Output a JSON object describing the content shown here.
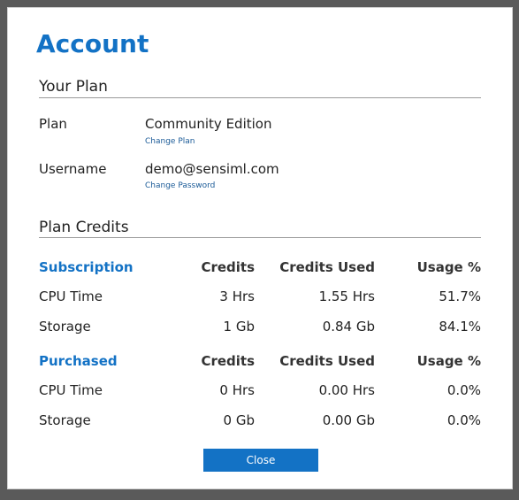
{
  "dialog": {
    "title": "Account",
    "your_plan": {
      "heading": "Your Plan",
      "plan_label": "Plan",
      "plan_value": "Community Edition",
      "change_plan": "Change Plan",
      "username_label": "Username",
      "username_value": "demo@sensiml.com",
      "change_password": "Change Password"
    },
    "plan_credits": {
      "heading": "Plan Credits",
      "subscription": {
        "headers": [
          "Subscription",
          "Credits",
          "Credits Used",
          "Usage %"
        ],
        "rows": [
          [
            "CPU Time",
            "3 Hrs",
            "1.55 Hrs",
            "51.7%"
          ],
          [
            "Storage",
            "1 Gb",
            "0.84 Gb",
            "84.1%"
          ]
        ]
      },
      "purchased": {
        "headers": [
          "Purchased",
          "Credits",
          "Credits Used",
          "Usage %"
        ],
        "rows": [
          [
            "CPU Time",
            "0 Hrs",
            "0.00 Hrs",
            "0.0%"
          ],
          [
            "Storage",
            "0 Gb",
            "0.00 Gb",
            "0.0%"
          ]
        ]
      }
    },
    "close_label": "Close"
  }
}
